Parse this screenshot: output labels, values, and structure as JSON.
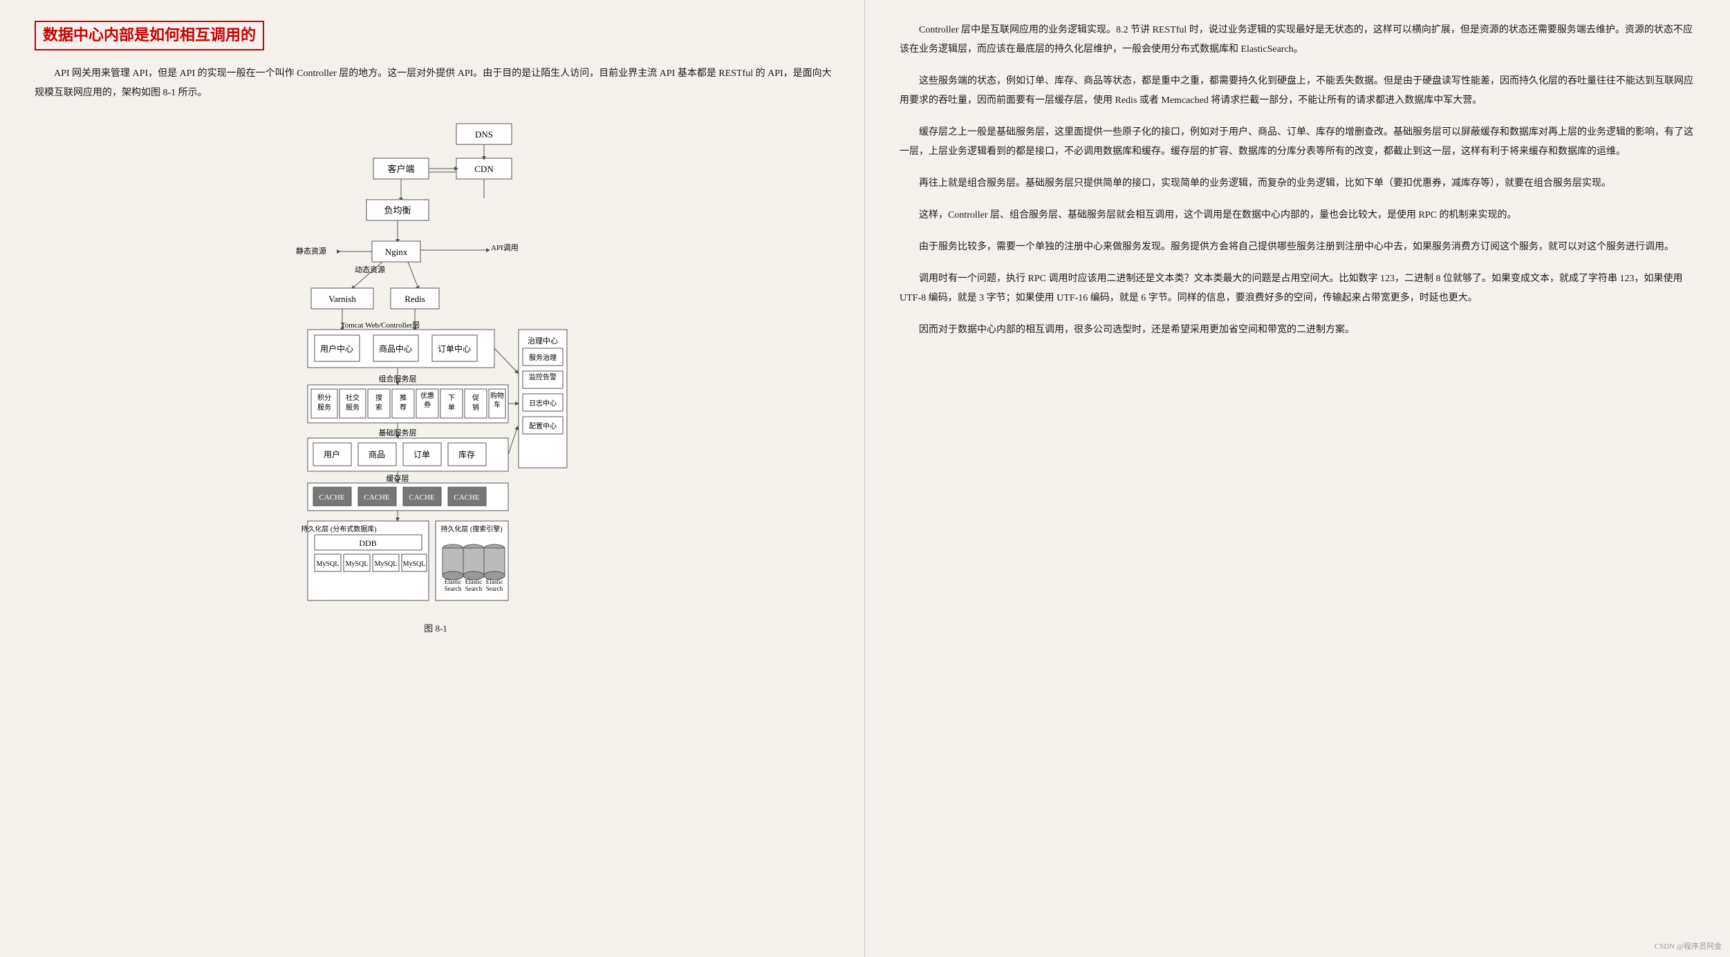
{
  "left": {
    "title": "数据中心内部是如何相互调用的",
    "intro": "API 网关用来管理 API，但是 API 的实现一般在一个叫作 Controller 层的地方。这一层对外提供 API。由于目的是让陌生人访问，目前业界主流 API 基本都是 RESTful 的 API，是面向大规模互联网应用的，架构如图 8-1 所示。",
    "figure_label": "图 8-1"
  },
  "right": {
    "paragraphs": [
      "Controller 层中是互联网应用的业务逻辑实现。8.2 节讲 RESTful 时，说过业务逻辑的实现最好是无状态的，这样可以横向扩展，但是资源的状态还需要服务端去维护。资源的状态不应该在业务逻辑层，而应该在最底层的持久化层维护，一般会使用分布式数据库和 ElasticSearch。",
      "这些服务端的状态，例如订单、库存、商品等状态，都是重中之重，都需要持久化到硬盘上，不能丢失数据。但是由于硬盘读写性能差，因而持久化层的吞吐量往往不能达到互联网应用要求的吞吐量，因而前面要有一层缓存层，使用 Redis 或者 Memcached 将请求拦截一部分，不能让所有的请求都进入数据库中军大营。",
      "缓存层之上一般是基础服务层，这里面提供一些原子化的接口，例如对于用户、商品、订单、库存的增删查改。基础服务层可以屏蔽缓存和数据库对再上层的业务逻辑的影响，有了这一层，上层业务逻辑看到的都是接口，不必调用数据库和缓存。缓存层的扩容、数据库的分库分表等所有的改变，都截止到这一层，这样有利于将来缓存和数据库的运维。",
      "再往上就是组合服务层。基础服务层只提供简单的接口，实现简单的业务逻辑，而复杂的业务逻辑，比如下单（要扣优惠券，减库存等），就要在组合服务层实现。",
      "这样，Controller 层、组合服务层、基础服务层就会相互调用，这个调用是在数据中心内部的，量也会比较大，是使用 RPC 的机制来实现的。",
      "由于服务比较多，需要一个单独的注册中心来做服务发现。服务提供方会将自己提供哪些服务注册到注册中心中去，如果服务消费方订阅这个服务，就可以对这个服务进行调用。",
      "调用时有一个问题，执行 RPC 调用时应该用二进制还是文本类？文本类最大的问题是占用空间大。比如数字 123，二进制 8 位就够了。如果变成文本，就成了字符串 123，如果使用 UTF-8 编码，就是 3 字节；如果使用 UTF-16 编码，就是 6 字节。同样的信息，要浪费好多的空间，传输起来占带宽更多，时延也更大。",
      "因而对于数据中心内部的相互调用，很多公司选型时，还是希望采用更加省空间和带宽的二进制方案。"
    ]
  },
  "watermark": "CSDN @程序员阿金"
}
